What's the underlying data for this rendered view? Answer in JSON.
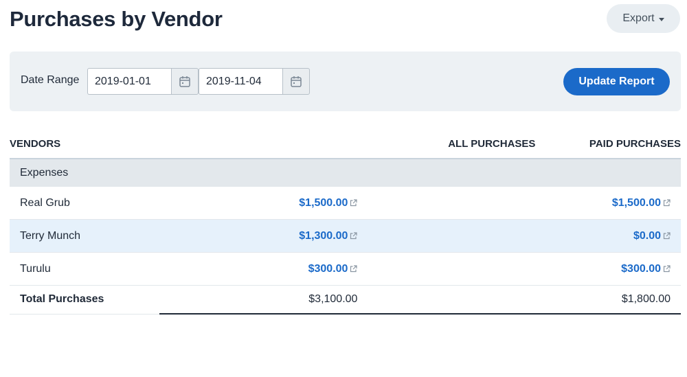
{
  "header": {
    "title": "Purchases by Vendor",
    "export_label": "Export"
  },
  "filters": {
    "date_range_label": "Date Range",
    "start_date": "2019-01-01",
    "end_date": "2019-11-04",
    "update_label": "Update Report"
  },
  "table": {
    "columns": [
      "VENDORS",
      "ALL PURCHASES",
      "PAID PURCHASES"
    ],
    "group_label": "Expenses",
    "rows": [
      {
        "vendor": "Real Grub",
        "all_purchases": "$1,500.00",
        "paid_purchases": "$1,500.00"
      },
      {
        "vendor": "Terry Munch",
        "all_purchases": "$1,300.00",
        "paid_purchases": "$0.00"
      },
      {
        "vendor": "Turulu",
        "all_purchases": "$300.00",
        "paid_purchases": "$300.00"
      }
    ],
    "total": {
      "label": "Total Purchases",
      "all_purchases": "$3,100.00",
      "paid_purchases": "$1,800.00"
    }
  },
  "colors": {
    "accent": "#1b6ac9",
    "panel": "#edf1f4",
    "highlight_row": "#e6f1fb"
  },
  "icons": [
    "caret-down-icon",
    "calendar-icon",
    "external-link-icon"
  ]
}
